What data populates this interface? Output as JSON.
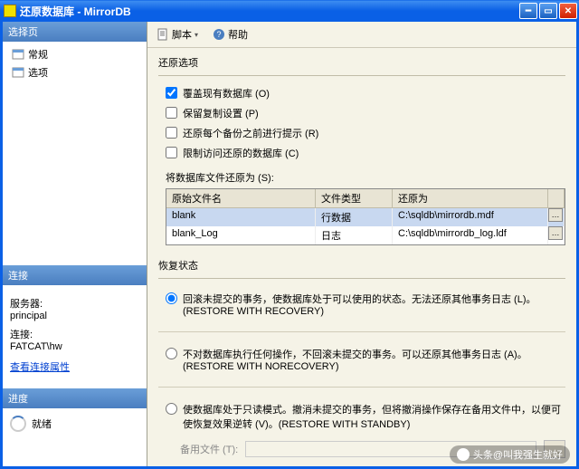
{
  "window": {
    "title": "还原数据库 - MirrorDB"
  },
  "sidebar": {
    "pages_hdr": "选择页",
    "items": [
      {
        "label": "常规"
      },
      {
        "label": "选项"
      }
    ],
    "conn_hdr": "连接",
    "server_lbl": "服务器:",
    "server_val": "principal",
    "conn_lbl": "连接:",
    "conn_val": "FATCAT\\hw",
    "view_props": "查看连接属性",
    "progress_hdr": "进度",
    "progress_val": "就绪"
  },
  "toolbar": {
    "script": "脚本",
    "help": "帮助"
  },
  "restore_opts": {
    "title": "还原选项",
    "overwrite": "覆盖现有数据库 (O)",
    "preserve": "保留复制设置 (P)",
    "prompt": "还原每个备份之前进行提示 (R)",
    "restrict": "限制访问还原的数据库 (C)",
    "files_lbl": "将数据库文件还原为 (S):",
    "cols": {
      "orig": "原始文件名",
      "type": "文件类型",
      "as": "还原为"
    },
    "rows": [
      {
        "orig": "blank",
        "type": "行数据",
        "as": "C:\\sqldb\\mirrordb.mdf"
      },
      {
        "orig": "blank_Log",
        "type": "日志",
        "as": "C:\\sqldb\\mirrordb_log.ldf"
      }
    ]
  },
  "recovery": {
    "title": "恢复状态",
    "r1": "回滚未提交的事务，使数据库处于可以使用的状态。无法还原其他事务日志 (L)。(RESTORE WITH RECOVERY)",
    "r2": "不对数据库执行任何操作，不回滚未提交的事务。可以还原其他事务日志 (A)。(RESTORE WITH NORECOVERY)",
    "r3": "使数据库处于只读模式。撤消未提交的事务，但将撤消操作保存在备用文件中，以便可使恢复效果逆转 (V)。(RESTORE WITH STANDBY)",
    "backup_lbl": "备用文件 (T):"
  },
  "watermark": "头条@叫我强生就好"
}
